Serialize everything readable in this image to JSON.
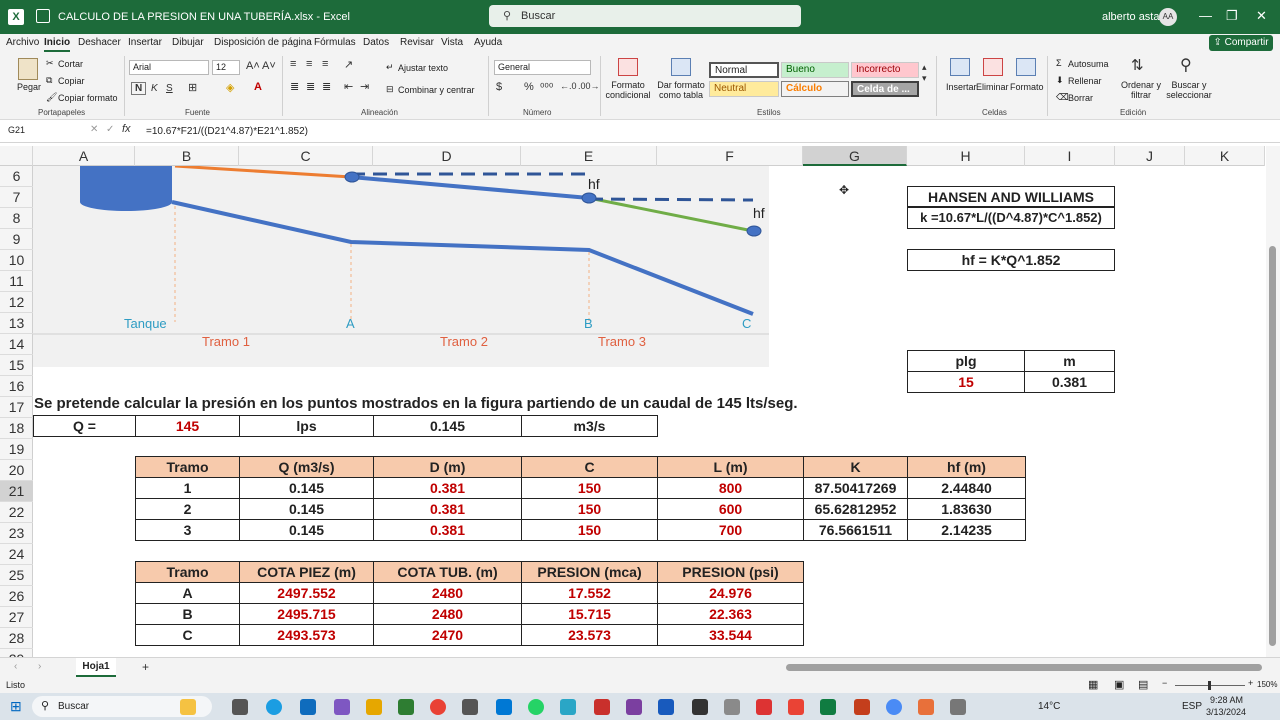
{
  "app": {
    "title": "CALCULO DE LA PRESION EN UNA TUBERÍA.xlsx  -  Excel",
    "search_placeholder": "Buscar",
    "user": "alberto astasio",
    "initials": "AA",
    "min": "—",
    "max": "❐",
    "close": "✕"
  },
  "menu": {
    "items": [
      "Archivo",
      "Inicio",
      "Deshacer",
      "Insertar",
      "Dibujar",
      "Disposición de página",
      "Fórmulas",
      "Datos",
      "Revisar",
      "Vista",
      "Ayuda"
    ],
    "share": "Compartir"
  },
  "ribbon": {
    "clipboard": {
      "paste": "Pegar",
      "cut": "Cortar",
      "copy": "Copiar",
      "format_painter": "Copiar formato",
      "label": "Portapapeles"
    },
    "font": {
      "name": "Arial",
      "size": "12",
      "bold": "N",
      "italic": "K",
      "underline": "S",
      "label": "Fuente"
    },
    "alignment": {
      "wrap": "Ajustar texto",
      "merge": "Combinar y centrar",
      "label": "Alineación"
    },
    "number": {
      "format": "General",
      "label": "Número"
    },
    "styles": {
      "conditional": "Formato condicional",
      "table": "Dar formato como tabla",
      "label": "Estilos",
      "normal": "Normal",
      "bueno": "Bueno",
      "incorrecto": "Incorrecto",
      "neutral": "Neutral",
      "calculo": "Cálculo",
      "celda": "Celda de ..."
    },
    "cells": {
      "insert": "Insertar",
      "delete": "Eliminar",
      "format": "Formato",
      "label": "Celdas"
    },
    "editing": {
      "autosum": "Autosuma",
      "fill": "Rellenar",
      "clear": "Borrar",
      "sort": "Ordenar y filtrar",
      "find": "Buscar y seleccionar",
      "label": "Edición"
    }
  },
  "formula_bar": {
    "cell_ref": "G21",
    "fx": "fx",
    "formula": "=10.67*F21/((D21^4.87)*E21^1.852)"
  },
  "columns": [
    "A",
    "B",
    "C",
    "D",
    "E",
    "F",
    "G",
    "H",
    "I",
    "J",
    "K"
  ],
  "rows": [
    "6",
    "7",
    "8",
    "9",
    "10",
    "11",
    "12",
    "13",
    "14",
    "15",
    "16",
    "17",
    "18",
    "19",
    "20",
    "21",
    "22",
    "23",
    "24",
    "25",
    "26",
    "27",
    "28",
    "29"
  ],
  "chart": {
    "labels": {
      "hf1": "hf",
      "hf2": "hf",
      "tanque": "Tanque",
      "a": "A",
      "b": "B",
      "c": "C",
      "tramo1": "Tramo 1",
      "tramo2": "Tramo 2",
      "tramo3": "Tramo 3"
    }
  },
  "hansen": {
    "title": "HANSEN AND WILLIAMS",
    "k_formula": "k =10.67*L/((D^4.87)*C^1.852)",
    "hf_formula": "hf = K*Q^1.852"
  },
  "units": {
    "plg_label": "plg",
    "m_label": "m",
    "plg_value": "15",
    "m_value": "0.381"
  },
  "statement": "Se pretende calcular la presión en los puntos mostrados en la figura partiendo de un caudal de 145 lts/seg.",
  "flow": {
    "q_label": "Q =",
    "q_lps": "145",
    "lps_unit": "lps",
    "q_m3s": "0.145",
    "m3s_unit": "m3/s"
  },
  "table1": {
    "headers": [
      "Tramo",
      "Q (m3/s)",
      "D (m)",
      "C",
      "L (m)",
      "K",
      "hf (m)"
    ],
    "rows": [
      [
        "1",
        "0.145",
        "0.381",
        "150",
        "800",
        "87.50417269",
        "2.44840"
      ],
      [
        "2",
        "0.145",
        "0.381",
        "150",
        "600",
        "65.62812952",
        "1.83630"
      ],
      [
        "3",
        "0.145",
        "0.381",
        "150",
        "700",
        "76.5661511",
        "2.14235"
      ]
    ]
  },
  "table2": {
    "headers": [
      "Tramo",
      "COTA PIEZ (m)",
      "COTA TUB. (m)",
      "PRESION (mca)",
      "PRESION (psi)"
    ],
    "rows": [
      [
        "A",
        "2497.552",
        "2480",
        "17.552",
        "24.976"
      ],
      [
        "B",
        "2495.715",
        "2480",
        "15.715",
        "22.363"
      ],
      [
        "C",
        "2493.573",
        "2470",
        "23.573",
        "33.544"
      ]
    ]
  },
  "sheet": {
    "tab": "Hoja1",
    "add": "+",
    "status": "Listo",
    "zoom": "150%"
  },
  "taskbar": {
    "search": "Buscar",
    "temp": "14°C",
    "lang": "ESP",
    "time": "9:28 AM",
    "date": "3/13/2024"
  }
}
